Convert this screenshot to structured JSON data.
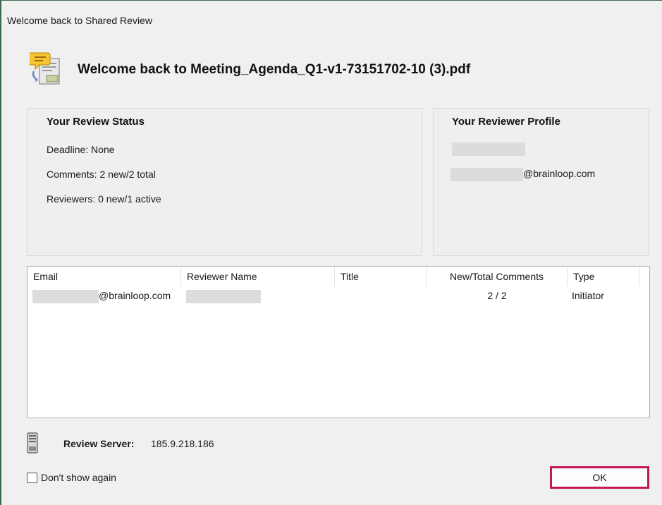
{
  "window": {
    "title": "Welcome back to Shared Review"
  },
  "header": {
    "title": "Welcome back to Meeting_Agenda_Q1-v1-73151702-10 (3).pdf",
    "icon": "shared-review-document-icon"
  },
  "review_status": {
    "title": "Your Review Status",
    "deadline": "Deadline: None",
    "comments": "Comments: 2 new/2 total",
    "reviewers": "Reviewers: 0 new/1 active"
  },
  "reviewer_profile": {
    "title": "Your Reviewer Profile",
    "email_suffix": "@brainloop.com"
  },
  "table": {
    "columns": [
      "Email",
      "Reviewer Name",
      "Title",
      "New/Total Comments",
      "Type"
    ],
    "rows": [
      {
        "email_suffix": "@brainloop.com",
        "reviewer_name": "",
        "title": "",
        "comments": "2 / 2",
        "type": "Initiator"
      }
    ]
  },
  "server": {
    "label": "Review Server:",
    "value": "185.9.218.186",
    "icon": "server-icon"
  },
  "dont_show_again": {
    "label": "Don't show again",
    "checked": false
  },
  "buttons": {
    "ok": "OK"
  },
  "colors": {
    "ok_focus_border": "#c2185b",
    "window_border": "#3a6b4c"
  }
}
